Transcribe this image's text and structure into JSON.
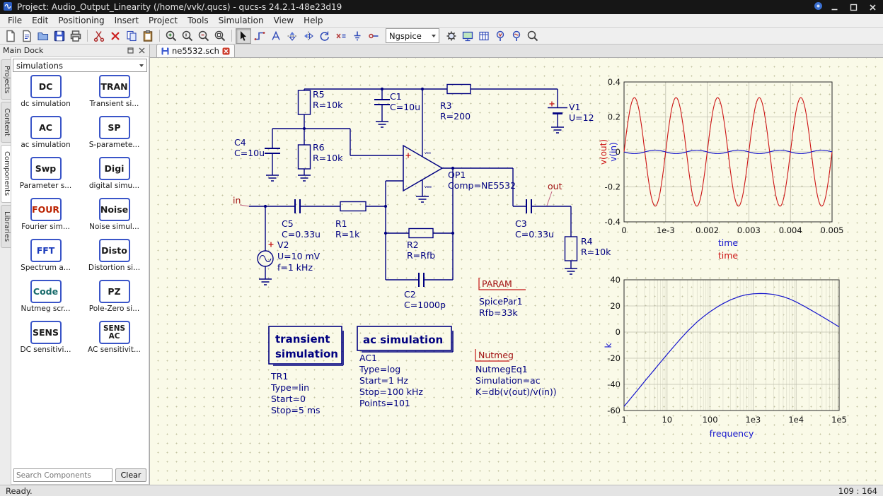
{
  "window": {
    "title": "Project: Audio_Output_Linearity (/home/vvk/.qucs) - qucs-s 24.2.1-48e23d19"
  },
  "menu": [
    "File",
    "Edit",
    "Positioning",
    "Insert",
    "Project",
    "Tools",
    "Simulation",
    "View",
    "Help"
  ],
  "toolbar": {
    "engine": "Ngspice"
  },
  "dock": {
    "title": "Main Dock",
    "side_tabs": [
      "Projects",
      "Content",
      "Components",
      "Libraries"
    ],
    "active_side_tab": "Components",
    "category": "simulations",
    "components": [
      {
        "icon": "DC",
        "label": "dc simulation",
        "color": "#1a1a1a"
      },
      {
        "icon": "TRAN",
        "label": "Transient si...",
        "color": "#1a1a1a"
      },
      {
        "icon": "AC",
        "label": "ac simulation",
        "color": "#1a1a1a"
      },
      {
        "icon": "SP",
        "label": "S-paramete...",
        "color": "#1a1a1a"
      },
      {
        "icon": "Swp",
        "label": "Parameter s...",
        "color": "#1a1a1a"
      },
      {
        "icon": "Digi",
        "label": "digital simu...",
        "color": "#1a1a1a"
      },
      {
        "icon": "FOUR",
        "label": "Fourier sim...",
        "color": "#bb2200"
      },
      {
        "icon": "Noise",
        "label": "Noise simul...",
        "color": "#1a1a1a"
      },
      {
        "icon": "FFT",
        "label": "Spectrum a...",
        "color": "#1a3abb"
      },
      {
        "icon": "Disto",
        "label": "Distortion si...",
        "color": "#1a1a1a"
      },
      {
        "icon": "Code",
        "label": "Nutmeg scr...",
        "color": "#166a6a"
      },
      {
        "icon": "PZ",
        "label": "Pole-Zero si...",
        "color": "#1a1a1a"
      },
      {
        "icon": "SENS",
        "label": "DC sensitivi...",
        "color": "#1a1a1a"
      },
      {
        "icon": "SENS AC",
        "label": "AC sensitivit...",
        "color": "#1a1a1a"
      }
    ],
    "search_placeholder": "Search Components",
    "clear_label": "Clear"
  },
  "document": {
    "tab_label": "ne5532.sch"
  },
  "statusbar": {
    "left": "Ready.",
    "right": "109 : 164"
  },
  "schematic": {
    "r5": [
      "R5",
      "R=10k"
    ],
    "c1": [
      "C1",
      "C=10u"
    ],
    "r3": [
      "R3",
      "R=200"
    ],
    "v1": [
      "V1",
      "U=12"
    ],
    "c4": [
      "C4",
      "C=10u"
    ],
    "r6": [
      "R6",
      "R=10k"
    ],
    "op1": [
      "OP1",
      "Comp=NE5532"
    ],
    "op1_pins": [
      "vcc",
      "vee"
    ],
    "c5": [
      "C5",
      "C=0.33u"
    ],
    "r1": [
      "R1",
      "R=1k"
    ],
    "v2": [
      "V2",
      "U=10 mV",
      "f=1 kHz"
    ],
    "r2": [
      "R2",
      "R=Rfb"
    ],
    "c2": [
      "C2",
      "C=1000p"
    ],
    "c3": [
      "C3",
      "C=0.33u"
    ],
    "r4": [
      "R4",
      "R=10k"
    ],
    "in_label": "in",
    "out_label": "out",
    "param": {
      "title": "PARAM",
      "lines": [
        "SpicePar1",
        "Rfb=33k"
      ]
    },
    "transient": {
      "title": [
        "transient",
        "simulation"
      ],
      "lines": [
        "TR1",
        "Type=lin",
        "Start=0",
        "Stop=5 ms"
      ]
    },
    "ac": {
      "title": "ac simulation",
      "lines": [
        "AC1",
        "Type=log",
        "Start=1 Hz",
        "Stop=100 kHz",
        "Points=101"
      ]
    },
    "nutmeg": {
      "title": "Nutmeg",
      "lines": [
        "NutmegEq1",
        "Simulation=ac",
        "K=db(v(out)/v(in))"
      ]
    }
  },
  "chart_data": [
    {
      "type": "line",
      "title": "",
      "xlim": [
        0,
        0.005
      ],
      "ylim": [
        -0.4,
        0.4
      ],
      "x_ticks": [
        "0",
        "1e-3",
        "0.002",
        "0.003",
        "0.004",
        "0.005"
      ],
      "y_ticks": [
        "0.4",
        "0.2",
        "0",
        "-0.2",
        "-0.4"
      ],
      "xlabels": [
        {
          "text": "time",
          "color": "#1414cc"
        },
        {
          "text": "time",
          "color": "#cc1414"
        }
      ],
      "ylabels": [
        {
          "text": "v(out)",
          "color": "#cc1414"
        },
        {
          "text": "v(in)",
          "color": "#1414cc"
        }
      ],
      "grid": true,
      "series": [
        {
          "name": "v(out)",
          "color": "#cc1414",
          "waveform": "sine",
          "amplitude": 0.31,
          "frequency_hz": 1000,
          "phase_deg": 0,
          "periods_shown": 5
        },
        {
          "name": "v(in)",
          "color": "#1414cc",
          "waveform": "sine",
          "amplitude": 0.01,
          "frequency_hz": 1000,
          "phase_deg": 180,
          "periods_shown": 5
        }
      ]
    },
    {
      "type": "line",
      "x_scale": "log",
      "xlim": [
        1,
        100000
      ],
      "ylim": [
        -60,
        40
      ],
      "x_ticks": [
        "1",
        "10",
        "100",
        "1e3",
        "1e4",
        "1e5"
      ],
      "y_ticks": [
        "40",
        "20",
        "0",
        "-20",
        "-40",
        "-60"
      ],
      "xlabel": {
        "text": "frequency",
        "color": "#1414cc"
      },
      "ylabel": {
        "text": "k",
        "color": "#1414cc"
      },
      "grid": true,
      "series": [
        {
          "name": "k",
          "color": "#1414cc",
          "x": [
            1,
            1.5,
            2,
            3,
            5,
            7,
            10,
            15,
            20,
            30,
            50,
            70,
            100,
            150,
            200,
            300,
            500,
            700,
            1000,
            1500,
            2000,
            3000,
            5000,
            7000,
            10000,
            15000,
            20000,
            30000,
            50000,
            70000,
            100000
          ],
          "y": [
            -56.9,
            -49.9,
            -44.9,
            -37.8,
            -29.0,
            -23.2,
            -17.1,
            -10.3,
            -5.6,
            0.7,
            7.8,
            11.8,
            15.6,
            19.4,
            21.8,
            24.7,
            27.4,
            28.6,
            29.3,
            29.5,
            29.4,
            28.8,
            27.1,
            25.4,
            23.1,
            20.0,
            17.7,
            14.3,
            10.0,
            7.1,
            4.0
          ]
        }
      ]
    }
  ]
}
